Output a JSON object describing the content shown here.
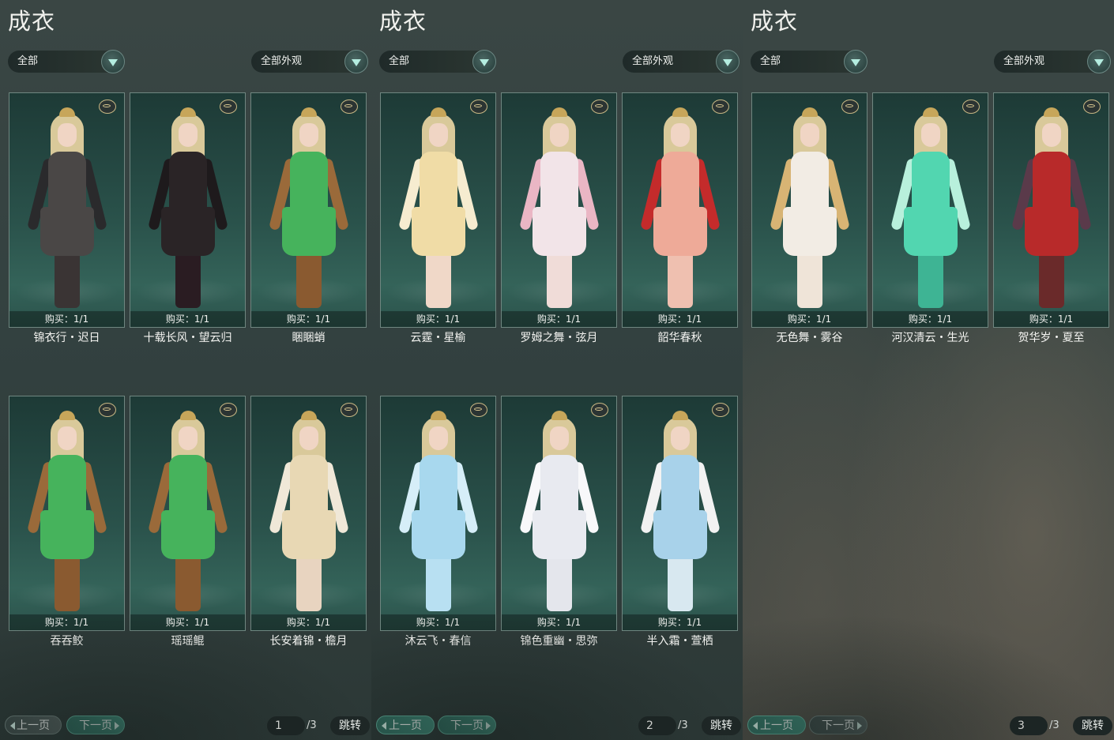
{
  "panels": [
    {
      "title": "成衣",
      "filter_left": "全部",
      "filter_right": "全部外观",
      "items": [
        {
          "name": "锦衣行・迟日",
          "buy": "购买：1/1",
          "outfit": "#4a4746",
          "accent": "#2a2a2c",
          "legs": "#3a3434"
        },
        {
          "name": "十载长风・望云归",
          "buy": "购买：1/1",
          "outfit": "#2a2426",
          "accent": "#1e1a1c",
          "legs": "#2a1c22"
        },
        {
          "name": "睏睏蛸",
          "buy": "购买：1/1",
          "outfit": "#46b35c",
          "accent": "#9a6a3a",
          "legs": "#8a5a30"
        },
        {
          "name": "吞吞鲛",
          "buy": "购买：1/1",
          "outfit": "#46b35c",
          "accent": "#9a6a3a",
          "legs": "#8a5a30"
        },
        {
          "name": "瑶瑶鲲",
          "buy": "购买：1/1",
          "outfit": "#46b35c",
          "accent": "#9a6a3a",
          "legs": "#8a5a30"
        },
        {
          "name": "长安着锦・檐月",
          "buy": "购买：1/1",
          "outfit": "#e8d8b4",
          "accent": "#f0e8d8",
          "legs": "#e8d4c0"
        }
      ],
      "prev_label": "上一页",
      "next_label": "下一页",
      "page_current": "1",
      "page_total": "/3",
      "jump_label": "跳转"
    },
    {
      "title": "成衣",
      "filter_left": "全部",
      "filter_right": "全部外观",
      "items": [
        {
          "name": "云霆・星榆",
          "buy": "购买：1/1",
          "outfit": "#f0dca6",
          "accent": "#f6ecd0",
          "legs": "#f0d8c8"
        },
        {
          "name": "罗姆之舞・弦月",
          "buy": "购买：1/1",
          "outfit": "#f2e4e8",
          "accent": "#eab6c4",
          "legs": "#f0dcd8"
        },
        {
          "name": "韶华春秋",
          "buy": "购买：1/1",
          "outfit": "#eeaa98",
          "accent": "#c42b2b",
          "legs": "#efc0b0"
        },
        {
          "name": "沐云飞・春信",
          "buy": "购买：1/1",
          "outfit": "#a8d8ee",
          "accent": "#d6eef8",
          "legs": "#b8e0f2"
        },
        {
          "name": "锦色重幽・思弥",
          "buy": "购买：1/1",
          "outfit": "#e8eaf0",
          "accent": "#f8f8fa",
          "legs": "#e4e6ec"
        },
        {
          "name": "半入霜・萱栖",
          "buy": "购买：1/1",
          "outfit": "#a8d2ea",
          "accent": "#f2f2f2",
          "legs": "#d8e8f0"
        }
      ],
      "prev_label": "上一页",
      "next_label": "下一页",
      "page_current": "2",
      "page_total": "/3",
      "jump_label": "跳转"
    },
    {
      "title": "成衣",
      "filter_left": "全部",
      "filter_right": "全部外观",
      "items": [
        {
          "name": "无色舞・雾谷",
          "buy": "购买：1/1",
          "outfit": "#f2ece4",
          "accent": "#d8b474",
          "legs": "#efe4d8"
        },
        {
          "name": "河汉清云・生光",
          "buy": "购买：1/1",
          "outfit": "#52d6b0",
          "accent": "#b8f0dc",
          "legs": "#3eb494"
        },
        {
          "name": "贺华岁・夏至",
          "buy": "购买：1/1",
          "outfit": "#b82a2a",
          "accent": "#5a3a4a",
          "legs": "#6a2a2a"
        }
      ],
      "prev_label": "上一页",
      "next_label": "下一页",
      "page_current": "3",
      "page_total": "/3",
      "jump_label": "跳转"
    }
  ]
}
